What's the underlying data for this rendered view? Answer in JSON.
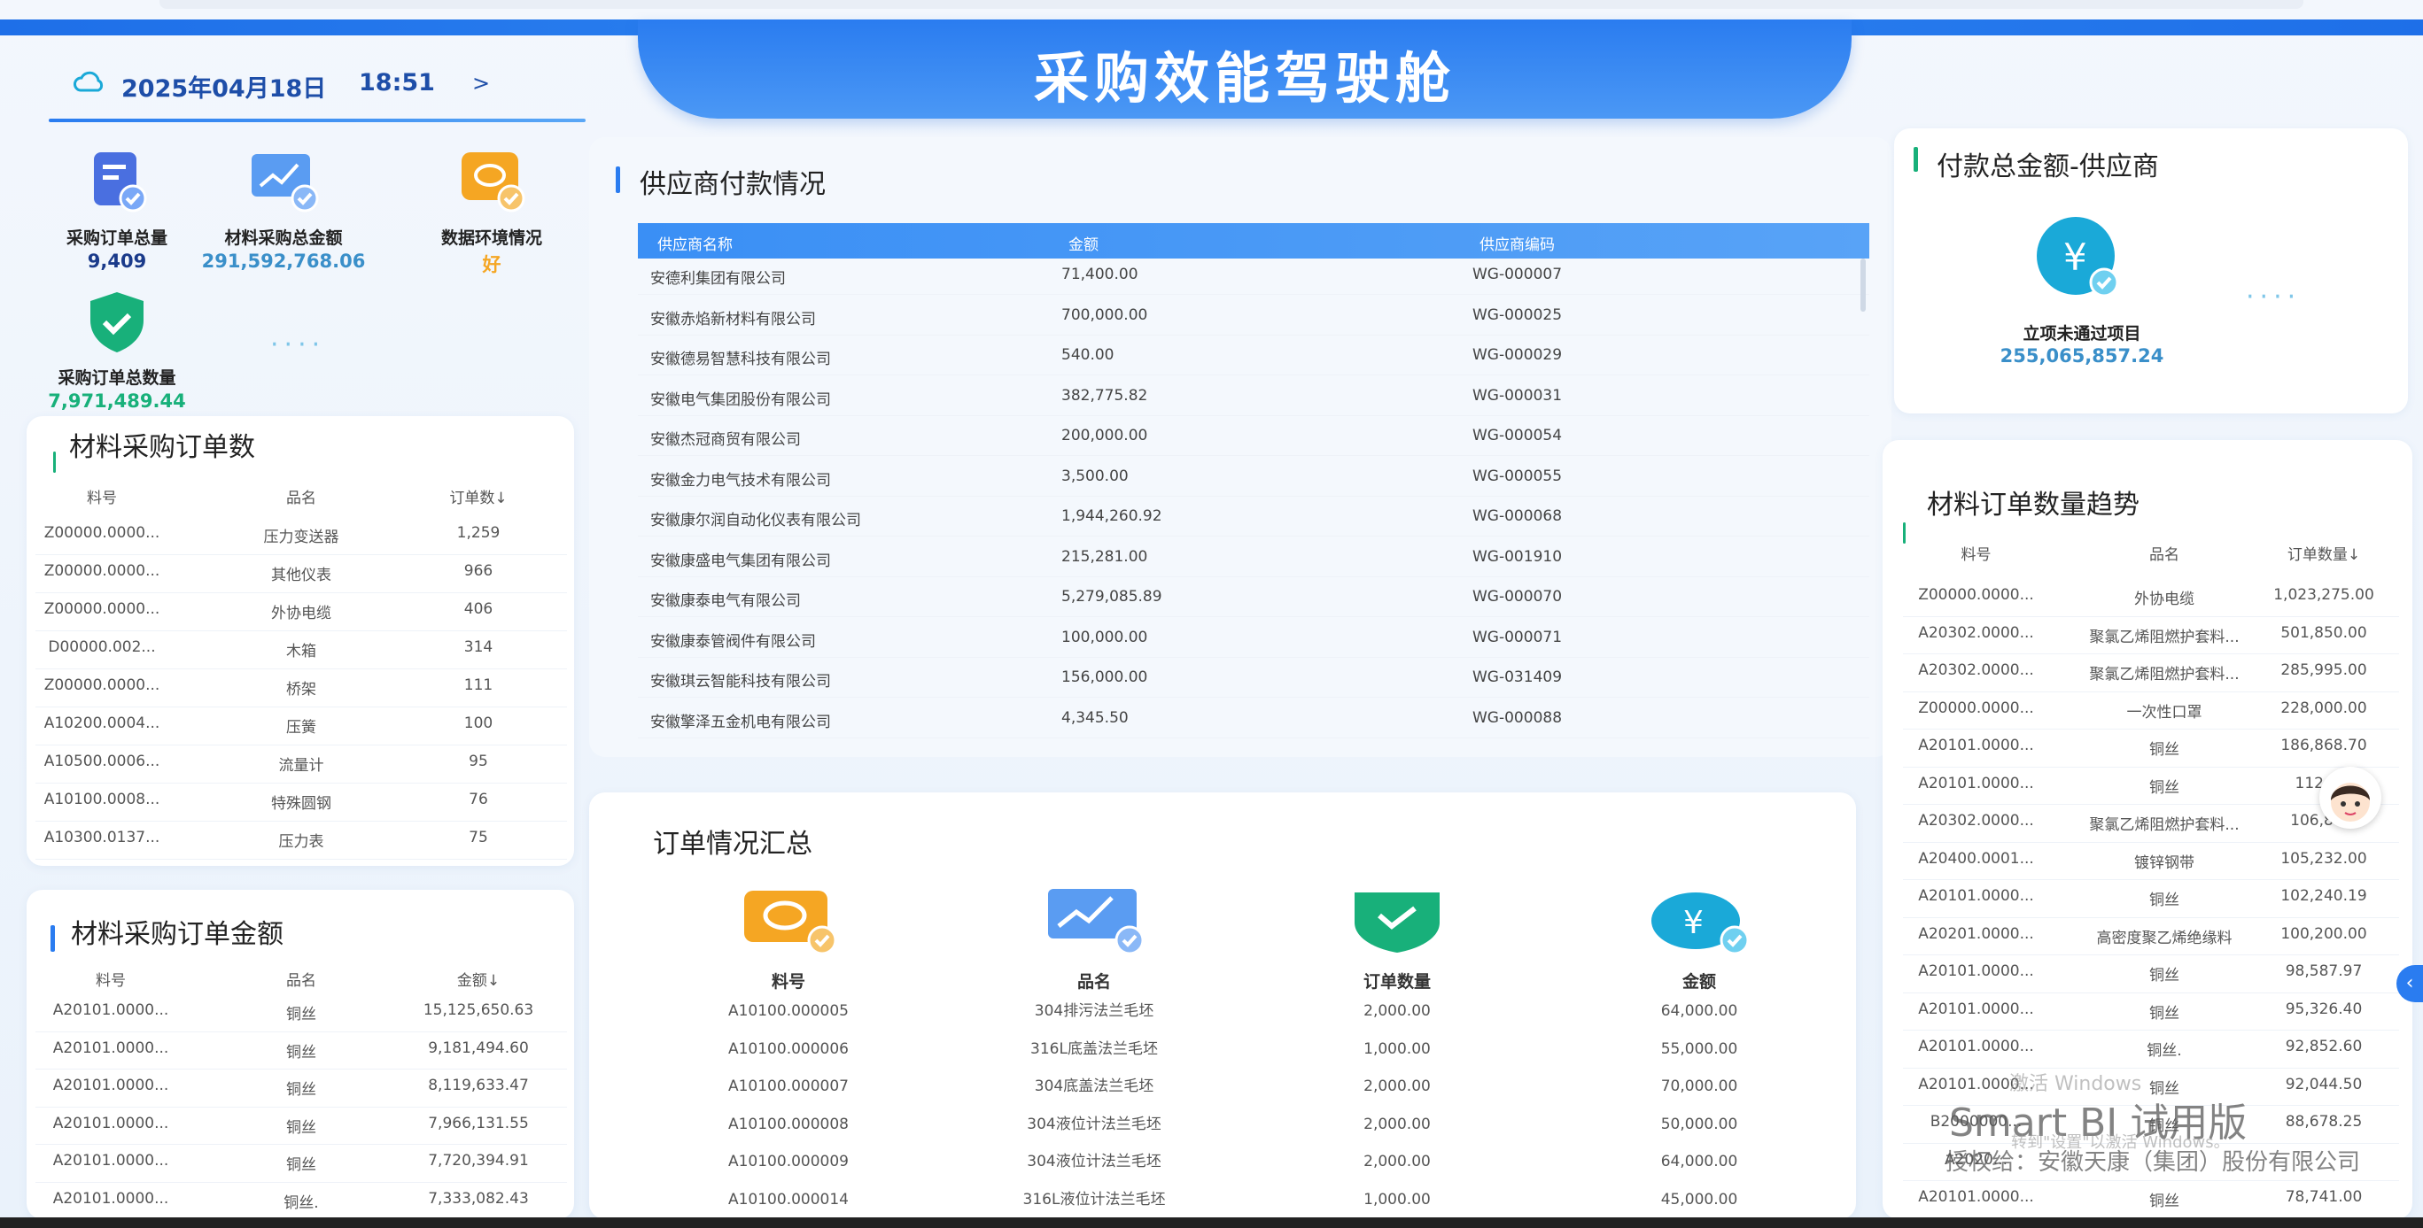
{
  "header": {
    "title": "采购效能驾驶舱"
  },
  "datebar": {
    "date": "2025年04月18日",
    "time": "18:51",
    "next": ">"
  },
  "kpis": [
    {
      "label": "采购订单总量",
      "value": "9,409",
      "color": "#1a3a8a"
    },
    {
      "label": "材料采购总金额",
      "value": "291,592,768.06",
      "color": "#3a8fc9"
    },
    {
      "label": "数据环境情况",
      "value": "好",
      "color": "#f5a623"
    },
    {
      "label": "采购订单总数量",
      "value": "7,971,489.44",
      "color": "#18b07a"
    }
  ],
  "material_orders": {
    "title": "材料采购订单数",
    "headers": [
      "料号",
      "品名",
      "订单数↓"
    ],
    "rows": [
      [
        "Z00000.0000...",
        "压力变送器",
        "1,259"
      ],
      [
        "Z00000.0000...",
        "其他仪表",
        "966"
      ],
      [
        "Z00000.0000...",
        "外协电缆",
        "406"
      ],
      [
        "D00000.002...",
        "木箱",
        "314"
      ],
      [
        "Z00000.0000...",
        "桥架",
        "111"
      ],
      [
        "A10200.0004...",
        "压簧",
        "100"
      ],
      [
        "A10500.0006...",
        "流量计",
        "95"
      ],
      [
        "A10100.0008...",
        "特殊圆钢",
        "76"
      ],
      [
        "A10300.0137...",
        "压力表",
        "75"
      ]
    ]
  },
  "material_amounts": {
    "title": "材料采购订单金额",
    "headers": [
      "料号",
      "品名",
      "金额↓"
    ],
    "rows": [
      [
        "A20101.0000...",
        "铜丝",
        "15,125,650.63"
      ],
      [
        "A20101.0000...",
        "铜丝",
        "9,181,494.60"
      ],
      [
        "A20101.0000...",
        "铜丝",
        "8,119,633.47"
      ],
      [
        "A20101.0000...",
        "铜丝",
        "7,966,131.55"
      ],
      [
        "A20101.0000...",
        "铜丝",
        "7,720,394.91"
      ],
      [
        "A20101.0000...",
        "铜丝.",
        "7,333,082.43"
      ]
    ]
  },
  "supplier": {
    "title": "供应商付款情况",
    "headers": [
      "供应商名称",
      "金额",
      "供应商编码"
    ],
    "rows": [
      [
        "安德利集团有限公司",
        "71,400.00",
        "WG-000007"
      ],
      [
        "安徽赤焰新材料有限公司",
        "700,000.00",
        "WG-000025"
      ],
      [
        "安徽德易智慧科技有限公司",
        "540.00",
        "WG-000029"
      ],
      [
        "安徽电气集团股份有限公司",
        "382,775.82",
        "WG-000031"
      ],
      [
        "安徽杰冠商贸有限公司",
        "200,000.00",
        "WG-000054"
      ],
      [
        "安徽金力电气技术有限公司",
        "3,500.00",
        "WG-000055"
      ],
      [
        "安徽康尔润自动化仪表有限公司",
        "1,944,260.92",
        "WG-000068"
      ],
      [
        "安徽康盛电气集团有限公司",
        "215,281.00",
        "WG-001910"
      ],
      [
        "安徽康泰电气有限公司",
        "5,279,085.89",
        "WG-000070"
      ],
      [
        "安徽康泰管阀件有限公司",
        "100,000.00",
        "WG-000071"
      ],
      [
        "安徽琪云智能科技有限公司",
        "156,000.00",
        "WG-031409"
      ],
      [
        "安徽擎泽五金机电有限公司",
        "4,345.50",
        "WG-000088"
      ]
    ]
  },
  "order_summary": {
    "title": "订单情况汇总",
    "headers": [
      "料号",
      "品名",
      "订单数量",
      "金额"
    ],
    "rows": [
      [
        "A10100.000005",
        "304排污法兰毛坯",
        "2,000.00",
        "64,000.00"
      ],
      [
        "A10100.000006",
        "316L底盖法兰毛坯",
        "1,000.00",
        "55,000.00"
      ],
      [
        "A10100.000007",
        "304底盖法兰毛坯",
        "2,000.00",
        "70,000.00"
      ],
      [
        "A10100.000008",
        "304液位计法兰毛坯",
        "2,000.00",
        "50,000.00"
      ],
      [
        "A10100.000009",
        "304液位计法兰毛坯",
        "2,000.00",
        "64,000.00"
      ],
      [
        "A10100.000014",
        "316L液位计法兰毛坯",
        "1,000.00",
        "45,000.00"
      ]
    ]
  },
  "payment": {
    "title": "付款总金额-供应商",
    "label": "立项未通过项目",
    "value": "255,065,857.24"
  },
  "trend": {
    "title": "材料订单数量趋势",
    "headers": [
      "料号",
      "品名",
      "订单数量↓"
    ],
    "rows": [
      [
        "Z00000.0000...",
        "外协电缆",
        "1,023,275.00"
      ],
      [
        "A20302.0000...",
        "聚氯乙烯阻燃护套料...",
        "501,850.00"
      ],
      [
        "A20302.0000...",
        "聚氯乙烯阻燃护套料...",
        "285,995.00"
      ],
      [
        "Z00000.0000...",
        "一次性口罩",
        "228,000.00"
      ],
      [
        "A20101.0000...",
        "铜丝",
        "186,868.70"
      ],
      [
        "A20101.0000...",
        "铜丝",
        "112,1..."
      ],
      [
        "A20302.0000...",
        "聚氯乙烯阻燃护套料...",
        "106,80..."
      ],
      [
        "A20400.0001...",
        "镀锌钢带",
        "105,232.00"
      ],
      [
        "A20101.0000...",
        "铜丝",
        "102,240.19"
      ],
      [
        "A20201.0000...",
        "高密度聚乙烯绝缘料",
        "100,200.00"
      ],
      [
        "A20101.0000...",
        "铜丝",
        "98,587.97"
      ],
      [
        "A20101.0000...",
        "铜丝",
        "95,326.40"
      ],
      [
        "A20101.0000...",
        "铜丝.",
        "92,852.60"
      ],
      [
        "A20101.0000...",
        "铜丝",
        "92,044.50"
      ],
      [
        "B2000000...",
        "铜丝",
        "88,678.25"
      ],
      [
        "A2020...",
        "",
        ""
      ],
      [
        "A20101.0000...",
        "铜丝",
        "78,741.00"
      ]
    ]
  },
  "watermark": {
    "line1": "Smart BI 试用版",
    "line2": "激活 Windows",
    "line3": "转到\"设置\"以激活 Windows。",
    "line4": "授权给：安徽天康（集团）股份有限公司"
  },
  "colors": {
    "accent": "#2a7cf0",
    "green": "#18b07a",
    "orange": "#f5a623"
  }
}
